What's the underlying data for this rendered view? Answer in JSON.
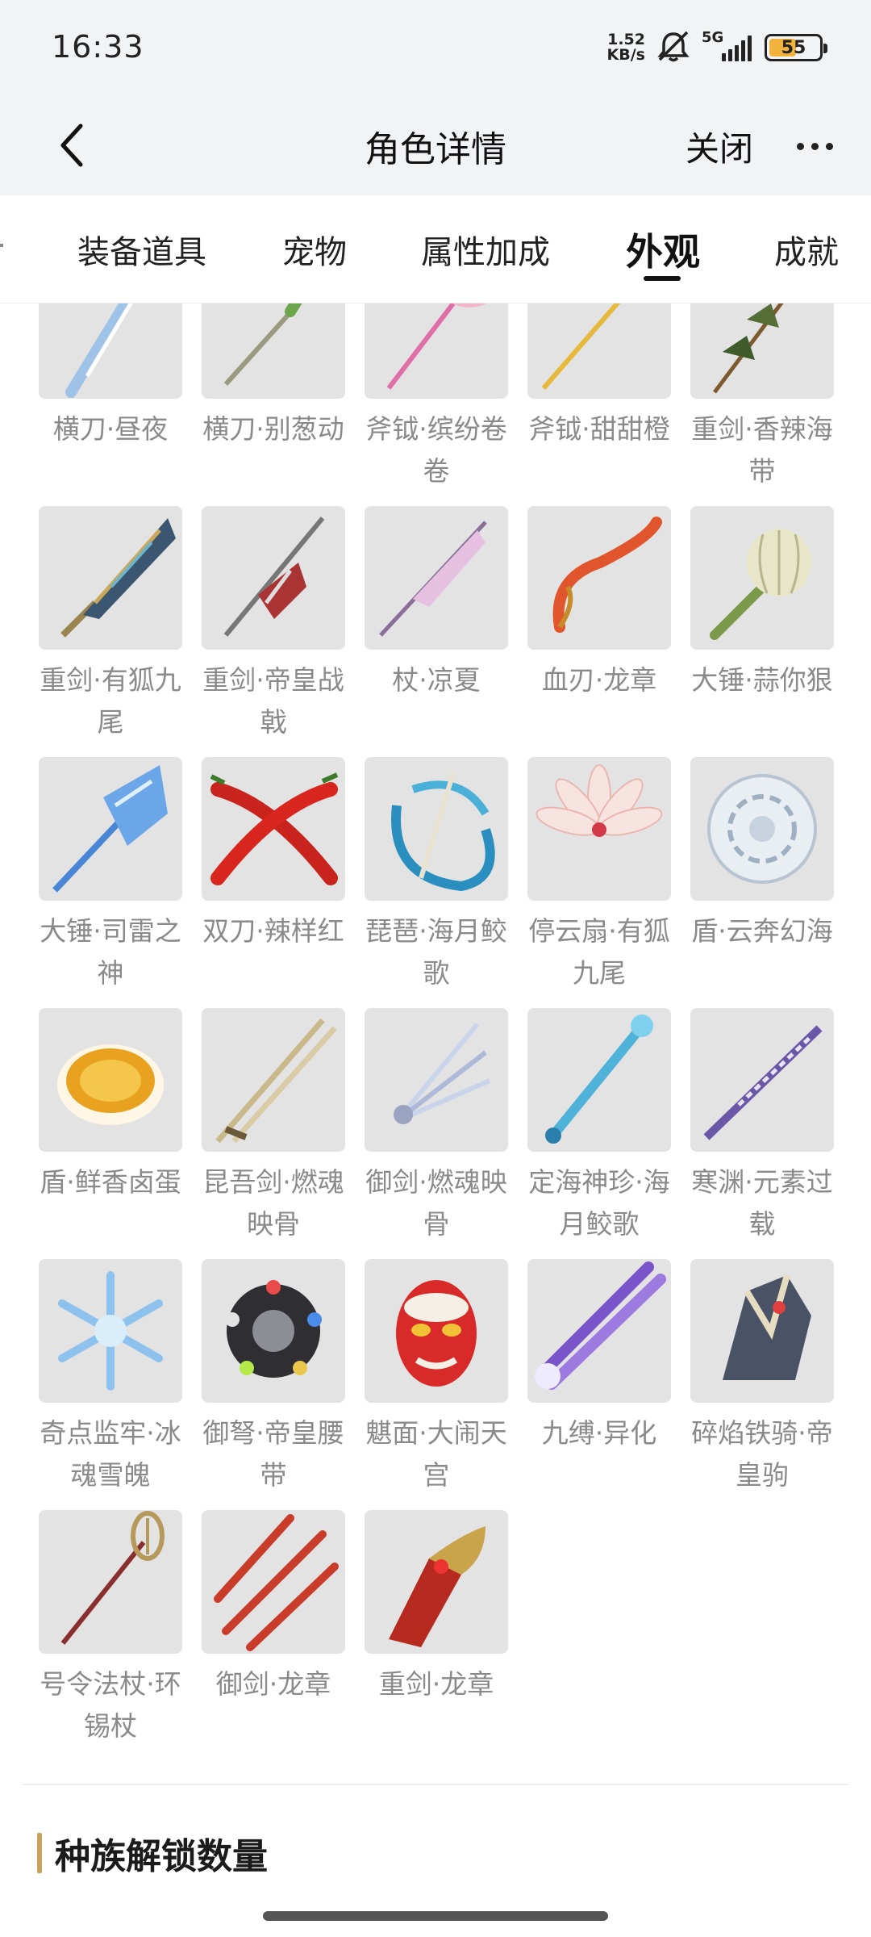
{
  "status_bar": {
    "time": "16:33",
    "net_speed_value": "1.52",
    "net_speed_unit": "KB/s",
    "network": "5G",
    "battery": "55",
    "battery_level_percent": 55,
    "battery_color": "#f2b33d"
  },
  "nav": {
    "title": "角色详情",
    "close_label": "关闭"
  },
  "tabs": [
    {
      "label": "装备道具",
      "active": false
    },
    {
      "label": "宠物",
      "active": false
    },
    {
      "label": "属性加成",
      "active": false
    },
    {
      "label": "外观",
      "active": true
    },
    {
      "label": "成就",
      "active": false
    }
  ],
  "items": [
    {
      "label": "横刀·昼夜",
      "icon": "blade-icon"
    },
    {
      "label": "横刀·别葱动",
      "icon": "scallion-blade-icon"
    },
    {
      "label": "斧钺·缤纷卷卷",
      "icon": "lollipop-axe-icon"
    },
    {
      "label": "斧钺·甜甜橙",
      "icon": "orange-axe-icon"
    },
    {
      "label": "重剑·香辣海带",
      "icon": "kelp-skewer-icon"
    },
    {
      "label": "重剑·有狐九尾",
      "icon": "fox-greatsword-icon"
    },
    {
      "label": "重剑·帝皇战戟",
      "icon": "emperor-halberd-icon"
    },
    {
      "label": "杖·凉夏",
      "icon": "parasol-staff-icon"
    },
    {
      "label": "血刃·龙章",
      "icon": "dragon-blade-icon"
    },
    {
      "label": "大锤·蒜你狠",
      "icon": "garlic-hammer-icon"
    },
    {
      "label": "大锤·司雷之神",
      "icon": "thunder-hammer-icon"
    },
    {
      "label": "双刀·辣样红",
      "icon": "chili-dual-blades-icon"
    },
    {
      "label": "琵琶·海月鲛歌",
      "icon": "pipa-icon"
    },
    {
      "label": "停云扇·有狐九尾",
      "icon": "lotus-fan-icon"
    },
    {
      "label": "盾·云奔幻海",
      "icon": "cloud-shield-icon"
    },
    {
      "label": "盾·鲜香卤蛋",
      "icon": "egg-shield-icon"
    },
    {
      "label": "昆吾剑·燃魂映骨",
      "icon": "twin-swords-icon"
    },
    {
      "label": "御剑·燃魂映骨",
      "icon": "flying-swords-icon"
    },
    {
      "label": "定海神珍·海月鲛歌",
      "icon": "sea-staff-icon"
    },
    {
      "label": "寒渊·元素过载",
      "icon": "element-lance-icon"
    },
    {
      "label": "奇点监牢·冰魂雪魄",
      "icon": "snowflake-icon"
    },
    {
      "label": "御弩·帝皇腰带",
      "icon": "emperor-belt-icon"
    },
    {
      "label": "魌面·大闹天宫",
      "icon": "monkey-mask-icon"
    },
    {
      "label": "九缚·异化",
      "icon": "purple-claws-icon"
    },
    {
      "label": "碎焰铁骑·帝皇驹",
      "icon": "emperor-steed-icon"
    },
    {
      "label": "号令法杖·环锡杖",
      "icon": "monk-staff-icon"
    },
    {
      "label": "御剑·龙章",
      "icon": "dragon-flying-swords-icon"
    },
    {
      "label": "重剑·龙章",
      "icon": "dragon-greatsword-icon"
    }
  ],
  "section": {
    "title": "种族解锁数量",
    "accent_color": "#c9a15e"
  }
}
